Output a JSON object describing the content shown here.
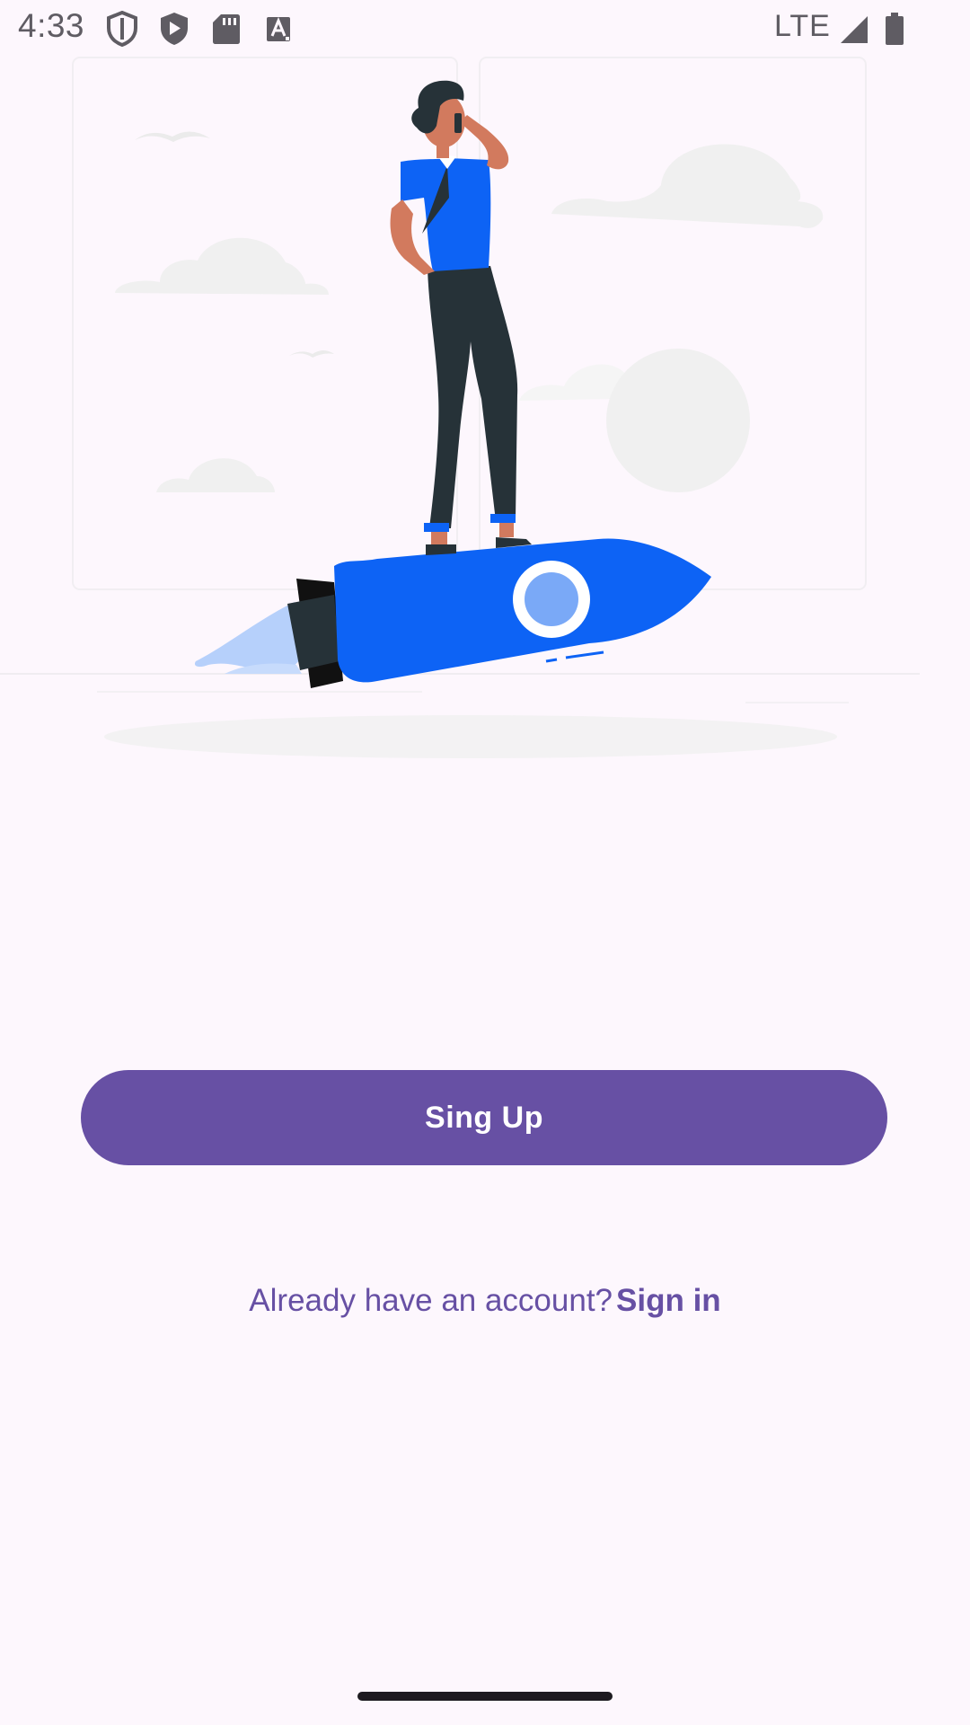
{
  "status_bar": {
    "time": "4:33",
    "network": "LTE",
    "icons": [
      "shield-icon",
      "play-store-icon",
      "sd-card-icon",
      "a-font-icon",
      "signal-icon",
      "battery-icon"
    ]
  },
  "illustration": {
    "description_icon": "rocket-man-illustration",
    "colors": {
      "rocket": "#0d63f5",
      "rocket_window_inner": "#7aa9f7",
      "flame": "#b6d0fb",
      "pants": "#263238",
      "skin": "#d27a5e",
      "cloud": "#f0f0f0"
    }
  },
  "actions": {
    "signup_label": "Sing Up",
    "signin_prompt": "Already have an account?",
    "signin_link": "Sign in"
  },
  "theme": {
    "primary": "#6750a4",
    "background": "#fdf7fd",
    "status_text": "#5f5c63"
  }
}
